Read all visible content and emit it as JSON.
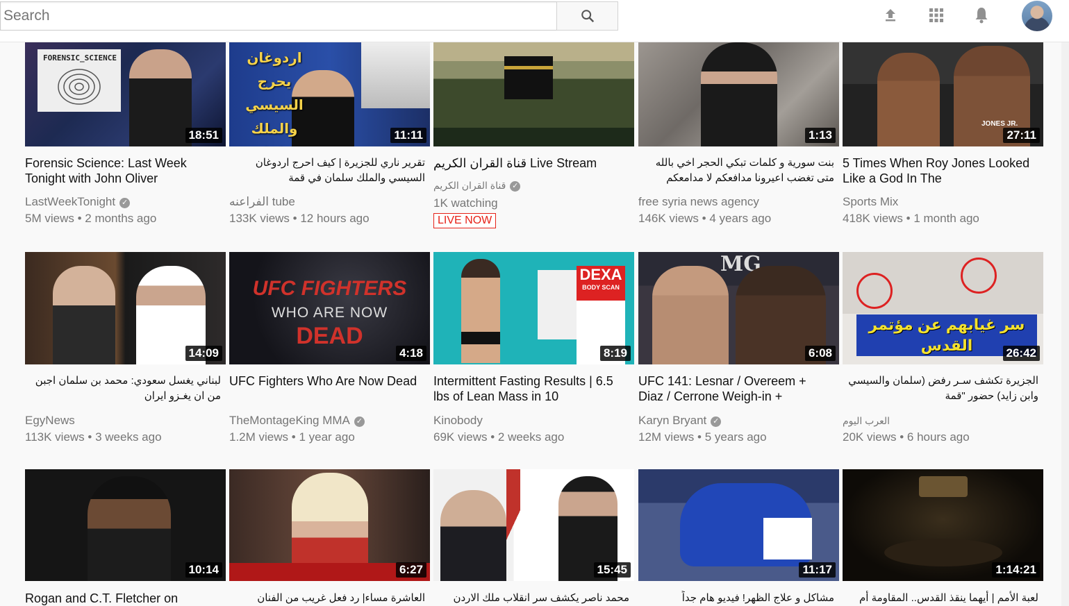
{
  "header": {
    "search_placeholder": "Search",
    "icons": [
      "search-icon",
      "upload-icon",
      "apps-icon",
      "notifications-icon",
      "avatar"
    ]
  },
  "videos": [
    {
      "title": "Forensic Science: Last Week Tonight with John Oliver",
      "channel": "LastWeekTonight",
      "verified": true,
      "views": "5M views",
      "age": "2 months ago",
      "duration": "18:51",
      "thumb_text": "FORENSIC_SCIENCE"
    },
    {
      "title": "تقرير ناري للجزيرة | كيف احرج اردوغان السيسي والملك سلمان في قمة",
      "channel": "الفراعنه tube",
      "verified": false,
      "views": "133K views",
      "age": "12 hours ago",
      "duration": "11:11",
      "thumb_text": "اردوغان يحرج السيسي والملك سلمان"
    },
    {
      "title": "قناة القران الكريم Live Stream",
      "channel": "قناة القران الكريم",
      "verified": true,
      "watching": "1K watching",
      "live_label": "LIVE NOW",
      "duration": ""
    },
    {
      "title": "بنت سورية و كلمات تبكي الحجر اخي بالله متى تغضب اعيرونا مدافعكم لا مدامعكم",
      "channel": "free syria news agency",
      "verified": false,
      "views": "146K views",
      "age": "4 years ago",
      "duration": "1:13"
    },
    {
      "title": "5 Times When Roy Jones Looked Like a God In The",
      "channel": "Sports Mix",
      "verified": false,
      "views": "418K views",
      "age": "1 month ago",
      "duration": "27:11",
      "thumb_text": "JONES JR."
    },
    {
      "title": "لبناني يغسل سعودي: محمد بن سلمان اجبن من ان يغـزو ايران",
      "channel": "EgyNews",
      "verified": false,
      "views": "113K views",
      "age": "3 weeks ago",
      "duration": "14:09"
    },
    {
      "title": "UFC Fighters Who Are Now Dead",
      "channel": "TheMontageKing MMA",
      "verified": true,
      "views": "1.2M views",
      "age": "1 year ago",
      "duration": "4:18",
      "thumb_text": [
        "UFC FIGHTERS",
        "WHO ARE NOW",
        "DEAD"
      ]
    },
    {
      "title": "Intermittent Fasting Results | 6.5 lbs of Lean Mass in 10",
      "channel": "Kinobody",
      "verified": false,
      "views": "69K views",
      "age": "2 weeks ago",
      "duration": "8:19",
      "thumb_text": [
        "DEXA",
        "BODY SCAN"
      ]
    },
    {
      "title": "UFC 141: Lesnar / Overeem + Diaz / Cerrone Weigh-in +",
      "channel": "Karyn Bryant",
      "verified": true,
      "views": "12M views",
      "age": "5 years ago",
      "duration": "6:08",
      "thumb_text": "MG"
    },
    {
      "title": "الجزيرة تكشف سـر رفض (سلمان والسيسي وابن زايد) حضور \"قمة",
      "channel": "العرب اليوم",
      "verified": false,
      "views": "20K views",
      "age": "6 hours ago",
      "duration": "26:42",
      "thumb_text": "سر غيابهم عن مؤتمر القدس"
    },
    {
      "title": "Rogan and C.T. Fletcher on",
      "duration": "10:14"
    },
    {
      "title": "العاشرة مساء| رد فعل غريب من الفنان",
      "duration": "6:27"
    },
    {
      "title": "محمد ناصر يكشف سر انقلاب ملك الاردن",
      "duration": "15:45"
    },
    {
      "title": "مشاكل و علاج الظهر! فيديو هام جداً",
      "duration": "11:17"
    },
    {
      "title": "لعبة الأمم | أيهما ينقذ القدس.. المقاومة أم",
      "duration": "1:14:21"
    }
  ]
}
